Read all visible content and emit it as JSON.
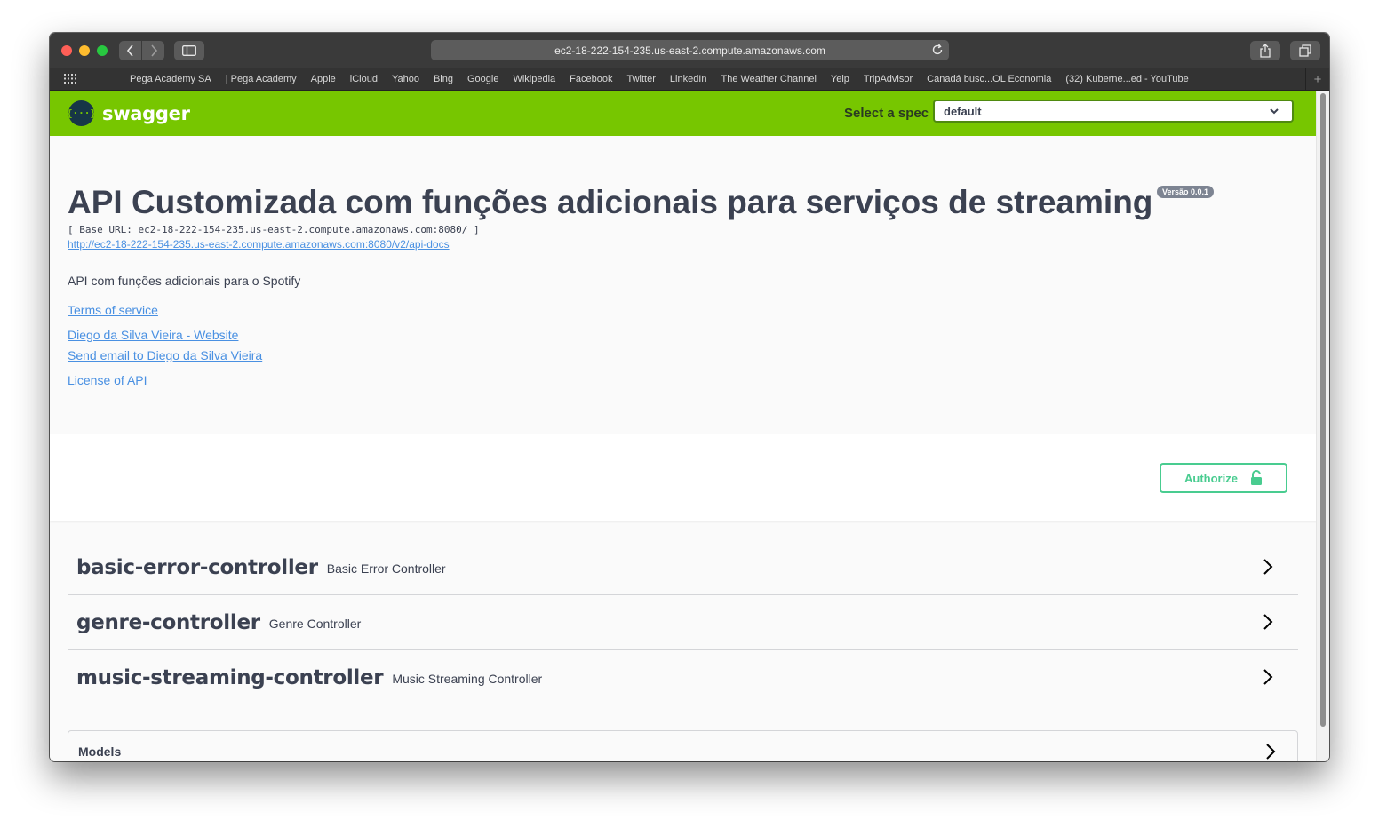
{
  "browser": {
    "url": "ec2-18-222-154-235.us-east-2.compute.amazonaws.com",
    "bookmarks": [
      "Pega Academy SA",
      "| Pega Academy",
      "Apple",
      "iCloud",
      "Yahoo",
      "Bing",
      "Google",
      "Wikipedia",
      "Facebook",
      "Twitter",
      "LinkedIn",
      "The Weather Channel",
      "Yelp",
      "TripAdvisor",
      "Canadá busc...OL Economia",
      "(32) Kuberne...ed - YouTube"
    ],
    "new_tab_label": "+"
  },
  "topbar": {
    "logo_glyph": "{···}",
    "logo_text": "swagger",
    "spec_label": "Select a spec",
    "spec_value": "default"
  },
  "info": {
    "title": "API Customizada com funções adicionais para serviços de streaming",
    "version": "Versão 0.0.1",
    "base_url": "[ Base URL: ec2-18-222-154-235.us-east-2.compute.amazonaws.com:8080/ ]",
    "api_docs_url": "http://ec2-18-222-154-235.us-east-2.compute.amazonaws.com:8080/v2/api-docs",
    "description": "API com funções adicionais para o Spotify",
    "terms": "Terms of service",
    "contact_website": "Diego da Silva Vieira - Website",
    "contact_email": "Send email to Diego da Silva Vieira",
    "license": "License of API"
  },
  "auth": {
    "authorize_label": "Authorize"
  },
  "tags": [
    {
      "name": "basic-error-controller",
      "description": "Basic Error Controller"
    },
    {
      "name": "genre-controller",
      "description": "Genre Controller"
    },
    {
      "name": "music-streaming-controller",
      "description": "Music Streaming Controller"
    }
  ],
  "models": {
    "label": "Models"
  },
  "colors": {
    "swagger_green": "#77c600",
    "authorize_green": "#49cc90",
    "link_blue": "#4990e2",
    "text_dark": "#3b4151"
  },
  "icons": [
    "back-icon",
    "forward-icon",
    "sidebar-icon",
    "reload-icon",
    "share-icon",
    "tabs-icon",
    "grid-icon",
    "chevron-down-icon",
    "unlock-icon",
    "chevron-right-icon"
  ]
}
